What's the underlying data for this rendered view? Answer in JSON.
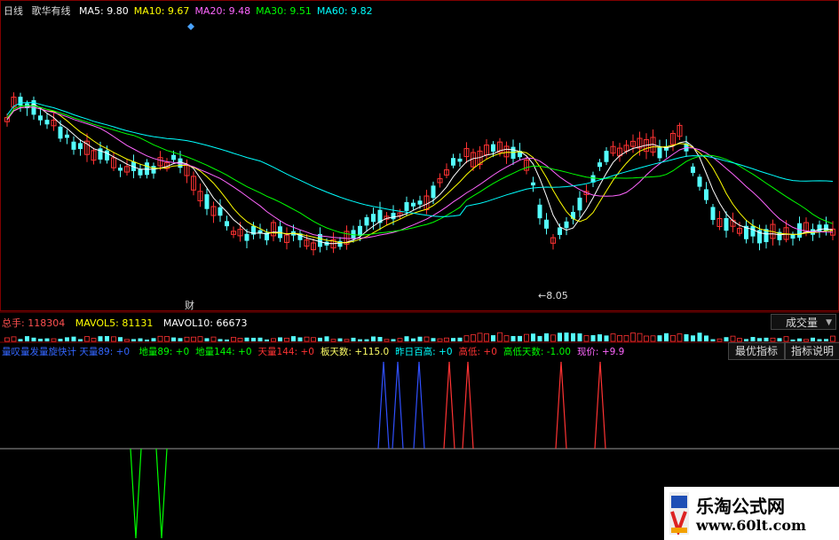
{
  "header": {
    "period": "日线",
    "indicator": "歌华有线",
    "ma": [
      {
        "label": "MA5:",
        "value": "9.80",
        "color": "#ffffff"
      },
      {
        "label": "MA10:",
        "value": "9.67",
        "color": "#ffff00"
      },
      {
        "label": "MA20:",
        "value": "9.48",
        "color": "#ff66ff"
      },
      {
        "label": "MA30:",
        "value": "9.51",
        "color": "#00ff00"
      },
      {
        "label": "MA60:",
        "value": "9.82",
        "color": "#00ffff"
      }
    ]
  },
  "price_panel": {
    "cai_marker": "财",
    "low_annotation": "←8.05"
  },
  "volume_header": {
    "total_label": "总手:",
    "total_value": "118304",
    "mavol5_label": "MAVOL5:",
    "mavol5_value": "81131",
    "mavol10_label": "MAVOL10:",
    "mavol10_value": "66673",
    "dropdown_selected": "成交量"
  },
  "indicator_header": {
    "prefix": "量叹量发量旋快计 天量89: +0",
    "items": [
      {
        "text": "地量89: +0",
        "color": "#00ff00"
      },
      {
        "text": "地量144: +0",
        "color": "#00ff00"
      },
      {
        "text": "天量144: +0",
        "color": "#ff3333"
      },
      {
        "text": "板天数: +115.0",
        "color": "#ffff66"
      },
      {
        "text": "昨日百高: +0",
        "color": "#00ffff"
      },
      {
        "text": "高低: +0",
        "color": "#ff3333"
      },
      {
        "text": "高低天数: -1.00",
        "color": "#00ff00"
      },
      {
        "text": "现价: +9.9",
        "color": "#ff66ff"
      }
    ]
  },
  "buttons": {
    "best_indicator": "最优指标",
    "indicator_help": "指标说明"
  },
  "watermark": {
    "title": "乐淘公式网",
    "url": "www.60lt.com"
  },
  "colors": {
    "up": "#ff3232",
    "down": "#54ffff",
    "ma5": "#ffffff",
    "ma10": "#ffff00",
    "ma20": "#ff66ff",
    "ma30": "#00ff00",
    "ma60": "#00ffff",
    "border": "#800000"
  }
}
